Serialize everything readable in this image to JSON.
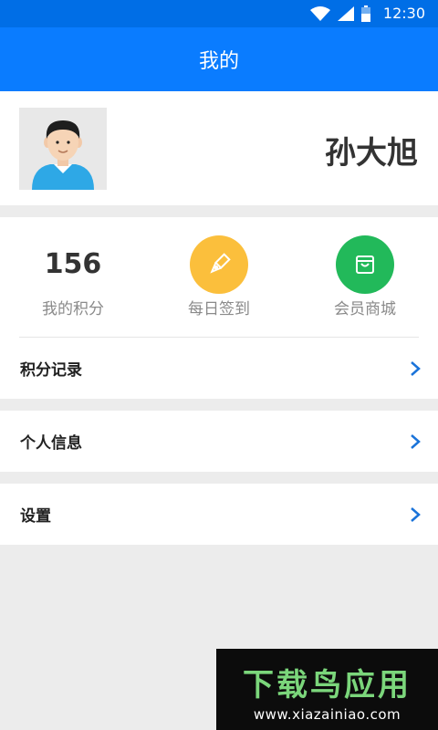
{
  "status_bar": {
    "time": "12:30",
    "icons": [
      "wifi-icon",
      "signal-icon",
      "battery-icon"
    ]
  },
  "app_bar": {
    "title": "我的"
  },
  "profile": {
    "name": "孙大旭",
    "avatar_icon": "user-avatar-icon"
  },
  "stats": {
    "points_value": "156",
    "points_label": "我的积分",
    "checkin_label": "每日签到",
    "checkin_icon": "pen-icon",
    "mall_label": "会员商城",
    "mall_icon": "shopping-bag-icon"
  },
  "menu": [
    {
      "label": "积分记录",
      "icon": "chevron-right-icon"
    },
    {
      "label": "个人信息",
      "icon": "chevron-right-icon"
    },
    {
      "label": "设置",
      "icon": "chevron-right-icon"
    }
  ],
  "watermark": {
    "title": "下载鸟应用",
    "url": "www.xiazainiao.com"
  },
  "colors": {
    "primary": "#0a7cff",
    "status_bar": "#006ee6",
    "checkin": "#fbbf3c",
    "mall": "#22b95a",
    "chevron": "#1a73d9"
  }
}
